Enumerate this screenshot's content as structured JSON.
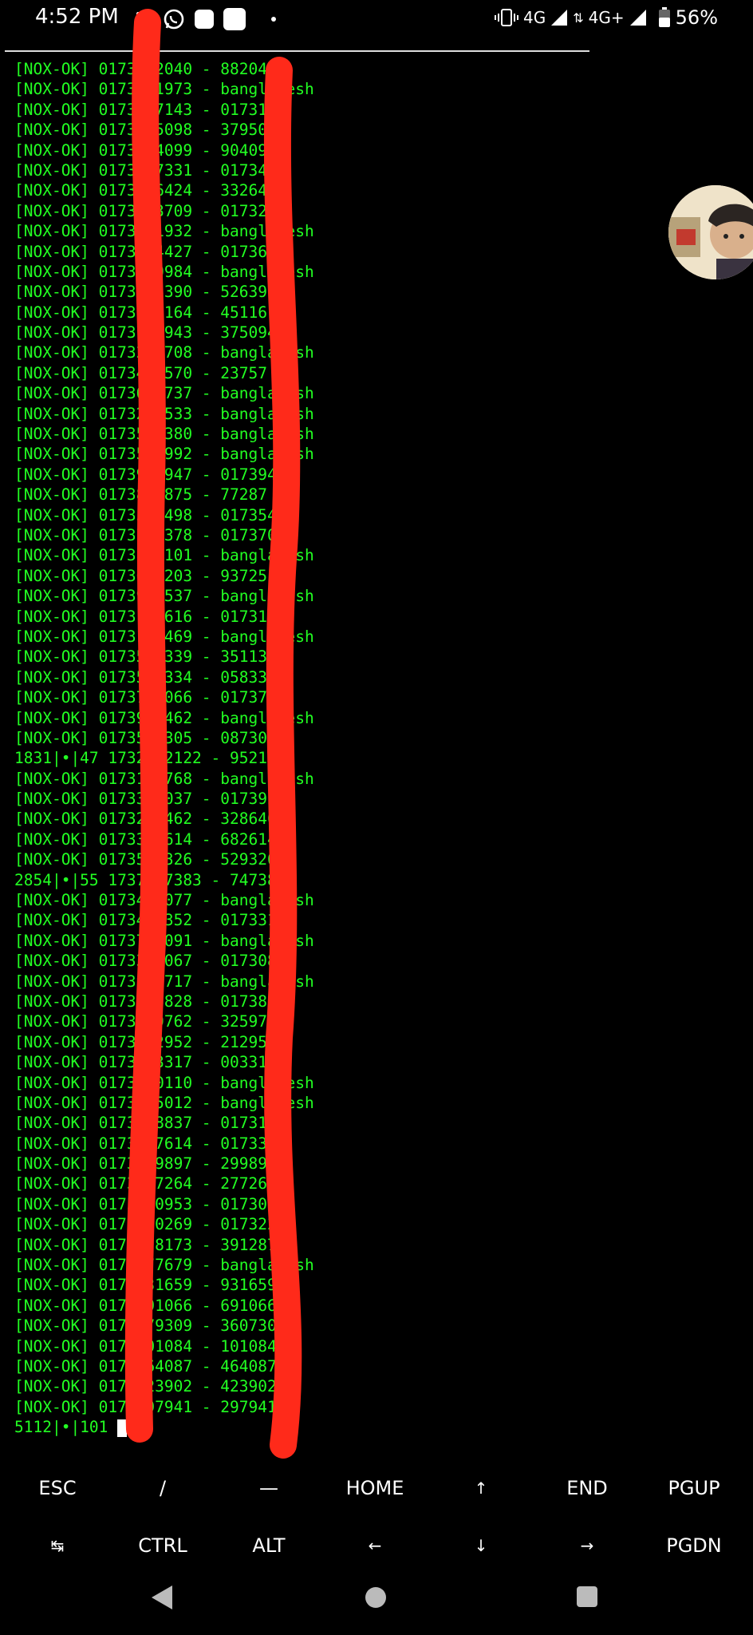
{
  "status": {
    "time": "4:52 PM",
    "network_1": "4G",
    "network_2": "4G+",
    "battery": "56%"
  },
  "terminal": {
    "lines": [
      "[NOX-OK] 0173882040 - 88204",
      "[NOX-OK] 0173041973 - bangladesh",
      "[NOX-OK] 0173197143 - 0173197",
      "[NOX-OK] 0173795098 - 3795098",
      "[NOX-OK] 0173904099 - 904099",
      "[NOX-OK] 0173407331 - 0173407",
      "[NOX-OK] 0173326424 - 3326424",
      "[NOX-OK] 0173213709 - 0173213",
      "[NOX-OK] 0173171932 - bangladesh",
      "[NOX-OK] 0173674427 - 0173674",
      "[NOX-OK] 0173270984 - bangladesh",
      "[NOX-OK] 0173526390 - 52639",
      "[NOX-OK] 0173451164 - 45116",
      "[NOX-OK] 0173750943 - 3750943",
      "[NOX-OK] 0173215708 - bangladesh",
      "[NOX-OK] 0173487570 - 23757",
      "[NOX-OK] 0173624737 - bangladesh",
      "[NOX-OK] 0173218533 - bangladesh",
      "[NOX-OK] 0173511380 - bangladesh",
      "[NOX-OK] 0173528992 - bangladesh",
      "[NOX-OK] 0173949947 - 0173946",
      "[NOX-OK] 0173847875 - 77287",
      "[NOX-OK] 0173579498 - 0173540",
      "[NOX-OK] 0173714378 - 0173706",
      "[NOX-OK] 0173881101 - bangladesh",
      "[NOX-OK] 0173695203 - 93725",
      "[NOX-OK] 0173977537 - bangladesh",
      "[NOX-OK] 0173145616 - 0173131",
      "[NOX-OK] 0173190469 - bangladesh",
      "[NOX-OK] 0173511339 - 3511339",
      "[NOX-OK] 0173503334 - 05833",
      "[NOX-OK] 0173758066 - 0173768",
      "[NOX-OK] 0173947462 - bangladesh",
      "[NOX-OK] 0173502305 - 087305",
      "1831|•|47 1732952122 - 952122",
      "[NOX-OK] 0173127768 - bangladesh",
      "[NOX-OK] 0173370037 - 0173920",
      "[NOX-OK] 0173276462 - 3286462",
      "[NOX-OK] 0173362614 - 682614",
      "[NOX-OK] 0173529326 - 529326",
      "2854|•|55 1737477383 - 747383",
      "[NOX-OK] 0173472077 - bangladesh",
      "[NOX-OK] 0173411352 - 0173311",
      "[NOX-OK] 0173747091 - bangladesh",
      "[NOX-OK] 0173388067 - 0173088",
      "[NOX-OK] 0173968717 - bangladesh",
      "[NOX-OK] 0173886828 - 0173886",
      "[NOX-OK] 0173259762 - 3259762",
      "[NOX-OK] 0173212952 - 212952",
      "[NOX-OK] 0173003317 - 003317",
      "[NOX-OK] 0173190110 - bangladesh",
      "[NOX-OK] 0173025012 - bangladesh",
      "[NOX-OK] 0173188837 - 0173188",
      "[NOX-OK] 0173397614 - 0173397",
      "[NOX-OK] 0173299897 - 299897",
      "[NOX-OK] 0173277264 - 277264",
      "[NOX-OK] 0173070953 - 0173070",
      "[NOX-OK] 0173220269 - 0173220",
      "[NOX-OK] 0173128173 - 3912873",
      "[NOX-OK] 0173877679 - bangladesh",
      "[NOX-OK] 0173931659 - 931659",
      "[NOX-OK] 0173691066 - 691066",
      "[NOX-OK] 0173079309 - 3607309",
      "[NOX-OK] 0173101084 - 101084",
      "[NOX-OK] 0173464087 - 464087",
      "[NOX-OK] 0173423902 - 423902",
      "[NOX-OK] 0173297941 - 297941"
    ],
    "prompt": "5112|•|101 "
  },
  "extra_keys": {
    "row1": [
      "ESC",
      "/",
      "—",
      "HOME",
      "↑",
      "END",
      "PGUP"
    ],
    "row2": [
      "↹",
      "CTRL",
      "ALT",
      "←",
      "↓",
      "→",
      "PGDN"
    ]
  },
  "colors": {
    "terminal_text": "#22ff22",
    "background": "#000000",
    "annotation": "#ff2a1a"
  },
  "icons": {
    "status_left": [
      "phone-icon",
      "whatsapp-icon",
      "notification-icon",
      "notification-icon",
      "more-dot-icon"
    ],
    "status_right": [
      "vibrate-icon",
      "signal-icon",
      "signal-icon",
      "battery-icon"
    ],
    "nav": [
      "back-icon",
      "home-icon",
      "recents-icon"
    ],
    "chat_head": "avatar"
  }
}
